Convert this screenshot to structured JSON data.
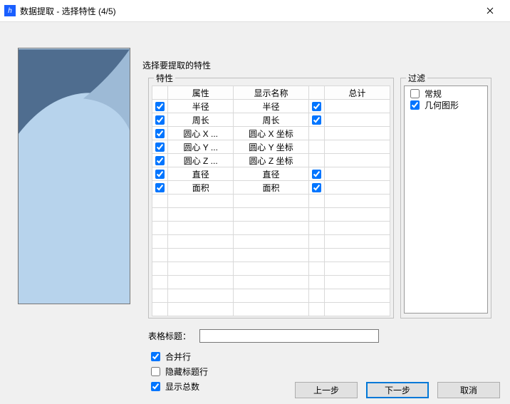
{
  "title": "数据提取 - 选择特性 (4/5)",
  "app_icon_letter": "h",
  "heading": "选择要提取的特性",
  "props_legend": "特性",
  "grid": {
    "headers": [
      "属性",
      "显示名称",
      "总计"
    ],
    "rows": [
      {
        "ck1": true,
        "attr": "半径",
        "disp": "半径",
        "ck2": true
      },
      {
        "ck1": true,
        "attr": "周长",
        "disp": "周长",
        "ck2": true
      },
      {
        "ck1": true,
        "attr": "圆心 X ...",
        "disp": "圆心 X 坐标",
        "ck2": null
      },
      {
        "ck1": true,
        "attr": "圆心 Y ...",
        "disp": "圆心 Y 坐标",
        "ck2": null
      },
      {
        "ck1": true,
        "attr": "圆心 Z ...",
        "disp": "圆心 Z 坐标",
        "ck2": null
      },
      {
        "ck1": true,
        "attr": "直径",
        "disp": "直径",
        "ck2": true
      },
      {
        "ck1": true,
        "attr": "面积",
        "disp": "面积",
        "ck2": true
      }
    ]
  },
  "filter_legend": "过滤",
  "filters": [
    {
      "label": "常规",
      "checked": false
    },
    {
      "label": "几何图形",
      "checked": true
    }
  ],
  "caption_label": "表格标题：",
  "caption_value": "",
  "option_merge": "合并行",
  "option_merge_checked": true,
  "option_hide": "隐藏标题行",
  "option_hide_checked": false,
  "option_total": "显示总数",
  "option_total_checked": true,
  "btn_back": "上一步",
  "btn_next": "下一步",
  "btn_cancel": "取消"
}
